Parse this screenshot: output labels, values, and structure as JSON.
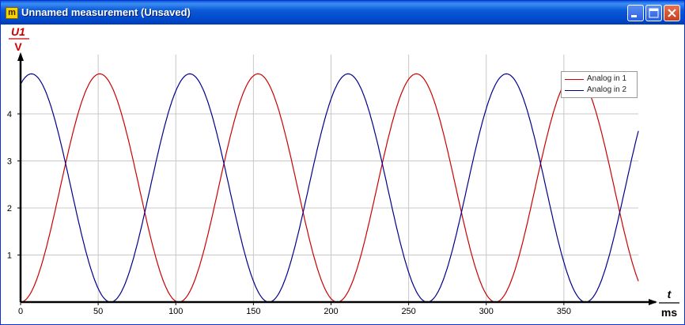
{
  "window": {
    "title": "Unnamed measurement (Unsaved)",
    "icon_letter": "m",
    "buttons": [
      "minimize-icon",
      "maximize-icon",
      "close-icon"
    ]
  },
  "chart_data": {
    "type": "line",
    "y_axis": {
      "symbol": "U1",
      "unit": "V",
      "ticks": [
        "1",
        "2",
        "3",
        "4"
      ],
      "ylim": [
        0,
        4.9
      ]
    },
    "x_axis": {
      "symbol": "t",
      "unit": "ms",
      "ticks": [
        "0",
        "50",
        "100",
        "150",
        "200",
        "250",
        "300",
        "350"
      ],
      "xlim": [
        0,
        410
      ]
    },
    "grid": true,
    "legend_placement": "top-right",
    "series": [
      {
        "name": "Analog in 1",
        "color": "#cc0000",
        "waveform": "sine",
        "period_ms": 102,
        "min": 0,
        "max": 4.85,
        "min_at_ms": 0,
        "x_end_ms": 398
      },
      {
        "name": "Analog in 2",
        "color": "#00008b",
        "waveform": "sine",
        "period_ms": 102,
        "min": 0,
        "max": 4.85,
        "min_at_ms": 58,
        "x_end_ms": 398
      }
    ]
  }
}
